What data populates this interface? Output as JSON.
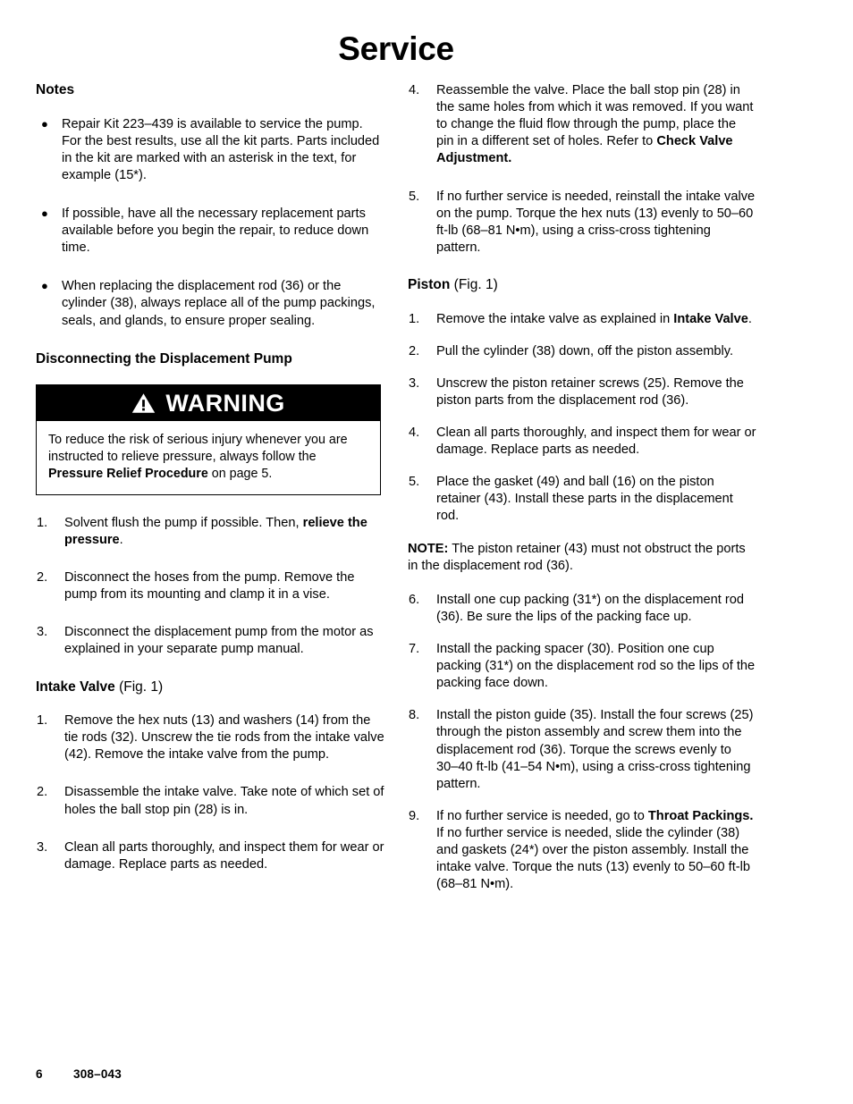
{
  "document": {
    "title": "Service"
  },
  "left_column": {
    "notes_heading": "Notes",
    "notes": [
      "Repair Kit 223–439 is available to service the pump. For the best results, use all the kit parts. Parts included in the kit are marked with an asterisk in the text, for example (15*).",
      "If possible, have all the necessary replacement parts available before you begin the repair, to reduce down time.",
      "When replacing the displacement rod (36) or the cylinder (38), always replace all of the pump packings, seals, and glands, to ensure proper sealing."
    ],
    "disconnect_heading": "Disconnecting the Displacement Pump",
    "warning": {
      "icon": "warning-triangle-icon",
      "label": "WARNING",
      "text_before": "To reduce the risk of serious injury whenever you are instructed to relieve pressure, always follow the ",
      "text_bold": "Pressure Relief Procedure",
      "text_after": " on page 5."
    },
    "disconnect_steps": [
      {
        "number": "1.",
        "text_before": "Solvent flush the pump if possible. Then, ",
        "text_bold": "relieve the pressure",
        "text_after": "."
      },
      {
        "number": "2.",
        "text_before": "Disconnect the hoses from the pump. Remove the pump from its mounting and clamp it in a vise.",
        "text_bold": "",
        "text_after": ""
      },
      {
        "number": "3.",
        "text_before": "Disconnect the displacement pump from the motor as explained in your separate pump manual.",
        "text_bold": "",
        "text_after": ""
      }
    ],
    "intake_heading_bold": "Intake Valve",
    "intake_heading_normal": " (Fig. 1)",
    "intake_steps": [
      {
        "number": "1.",
        "text_before": "Remove the hex nuts (13) and washers (14) from the tie rods (32). Unscrew the tie rods from the intake valve (42). Remove the intake valve from the pump.",
        "text_bold": "",
        "text_after": ""
      },
      {
        "number": "2.",
        "text_before": "Disassemble the intake valve. Take note of which set of holes the ball stop pin (28) is in.",
        "text_bold": "",
        "text_after": ""
      },
      {
        "number": "3.",
        "text_before": "Clean all parts thoroughly, and inspect them for wear or damage. Replace parts as needed.",
        "text_bold": "",
        "text_after": ""
      }
    ]
  },
  "right_column": {
    "intake_steps_continued": [
      {
        "number": "4.",
        "text_before": "Reassemble the valve. Place the ball stop pin (28) in the same holes from which it was removed. If you want to change the fluid flow through the pump, place the pin in a different set of holes. Refer to ",
        "text_bold": "Check Valve Adjustment.",
        "text_after": ""
      },
      {
        "number": "5.",
        "text_before": "If no further service is needed, reinstall the intake valve on the pump. Torque the hex nuts (13) evenly to 50–60  ft-lb (68–81 N•m), using a criss-cross tightening pattern.",
        "text_bold": "",
        "text_after": ""
      }
    ],
    "piston_heading_bold": "Piston",
    "piston_heading_normal": " (Fig. 1)",
    "piston_steps_part1": [
      {
        "number": "1.",
        "text_before": "Remove the intake valve as explained in ",
        "text_bold": "Intake Valve",
        "text_after": "."
      },
      {
        "number": "2.",
        "text_before": "Pull the cylinder (38) down, off the piston assembly.",
        "text_bold": "",
        "text_after": ""
      },
      {
        "number": "3.",
        "text_before": "Unscrew the piston retainer screws (25). Remove the piston parts from the displacement rod (36).",
        "text_bold": "",
        "text_after": ""
      },
      {
        "number": "4.",
        "text_before": "Clean all parts thoroughly, and inspect them for wear or damage. Replace parts as needed.",
        "text_bold": "",
        "text_after": ""
      },
      {
        "number": "5.",
        "text_before": "Place the gasket (49) and ball (16) on the piston retainer (43). Install these parts in the displacement rod.",
        "text_bold": "",
        "text_after": ""
      }
    ],
    "note_label": "NOTE:",
    "note_text": " The piston retainer (43) must not obstruct the ports in the displacement rod (36).",
    "piston_steps_part2": [
      {
        "number": "6.",
        "text_before": "Install one cup packing (31*) on the displacement rod (36). Be sure the lips of the packing face up.",
        "text_bold": "",
        "text_after": ""
      },
      {
        "number": "7.",
        "text_before": "Install the packing spacer (30). Position one cup packing (31*) on the displacement rod so the lips of the packing face down.",
        "text_bold": "",
        "text_after": ""
      },
      {
        "number": "8.",
        "text_before": "Install the piston guide (35). Install the four screws (25) through the piston assembly and screw them into the displacement rod (36). Torque the screws evenly to 30–40 ft-lb (41–54 N•m), using a criss-cross tightening pattern.",
        "text_bold": "",
        "text_after": ""
      },
      {
        "number": "9.",
        "text_before": "If no further service is needed, go to ",
        "text_bold": "Throat Packings.",
        "text_after": " If no further service is needed, slide the cylinder (38) and gaskets (24*) over the piston assembly. Install the intake valve. Torque the nuts (13) evenly to 50–60 ft-lb (68–81 N•m)."
      }
    ]
  },
  "footer": {
    "page_number": "6",
    "document_number": "308–043"
  }
}
